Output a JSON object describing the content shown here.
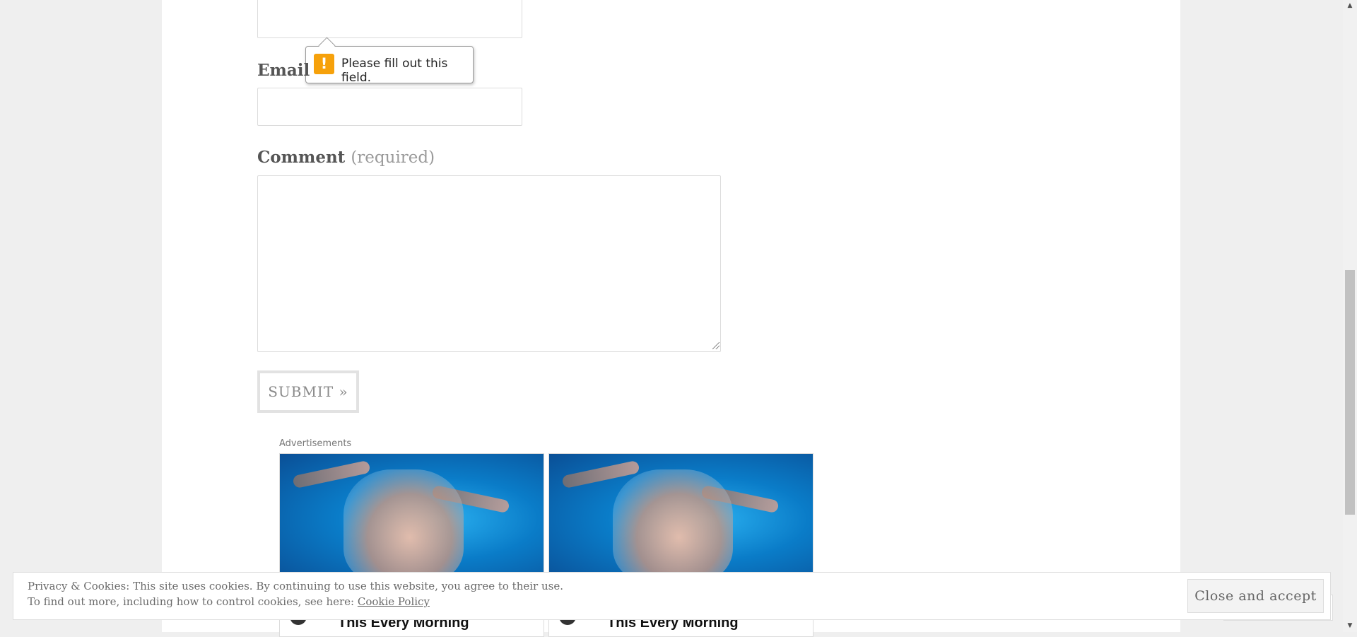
{
  "form": {
    "email_label": "Email",
    "comment_label": "Comment",
    "required_text": "(required)",
    "submit_label": "SUBMIT »"
  },
  "tooltip": {
    "icon": "!",
    "message": "Please fill out this field."
  },
  "ads": {
    "label": "Advertisements",
    "cards": [
      {
        "title": "This Every Morning"
      },
      {
        "title": "This Every Morning"
      }
    ]
  },
  "cookie_banner": {
    "line1": "Privacy & Cookies: This site uses cookies. By continuing to use this website, you agree to their use.",
    "line2_prefix": "To find out more, including how to control cookies, see here: ",
    "link_label": "Cookie Policy",
    "button_label": "Close and accept"
  },
  "scrollbar": {
    "up_icon": "▲",
    "down_icon": "▼"
  },
  "colors": {
    "warning": "#f6a10b",
    "page_background": "#efefef"
  }
}
